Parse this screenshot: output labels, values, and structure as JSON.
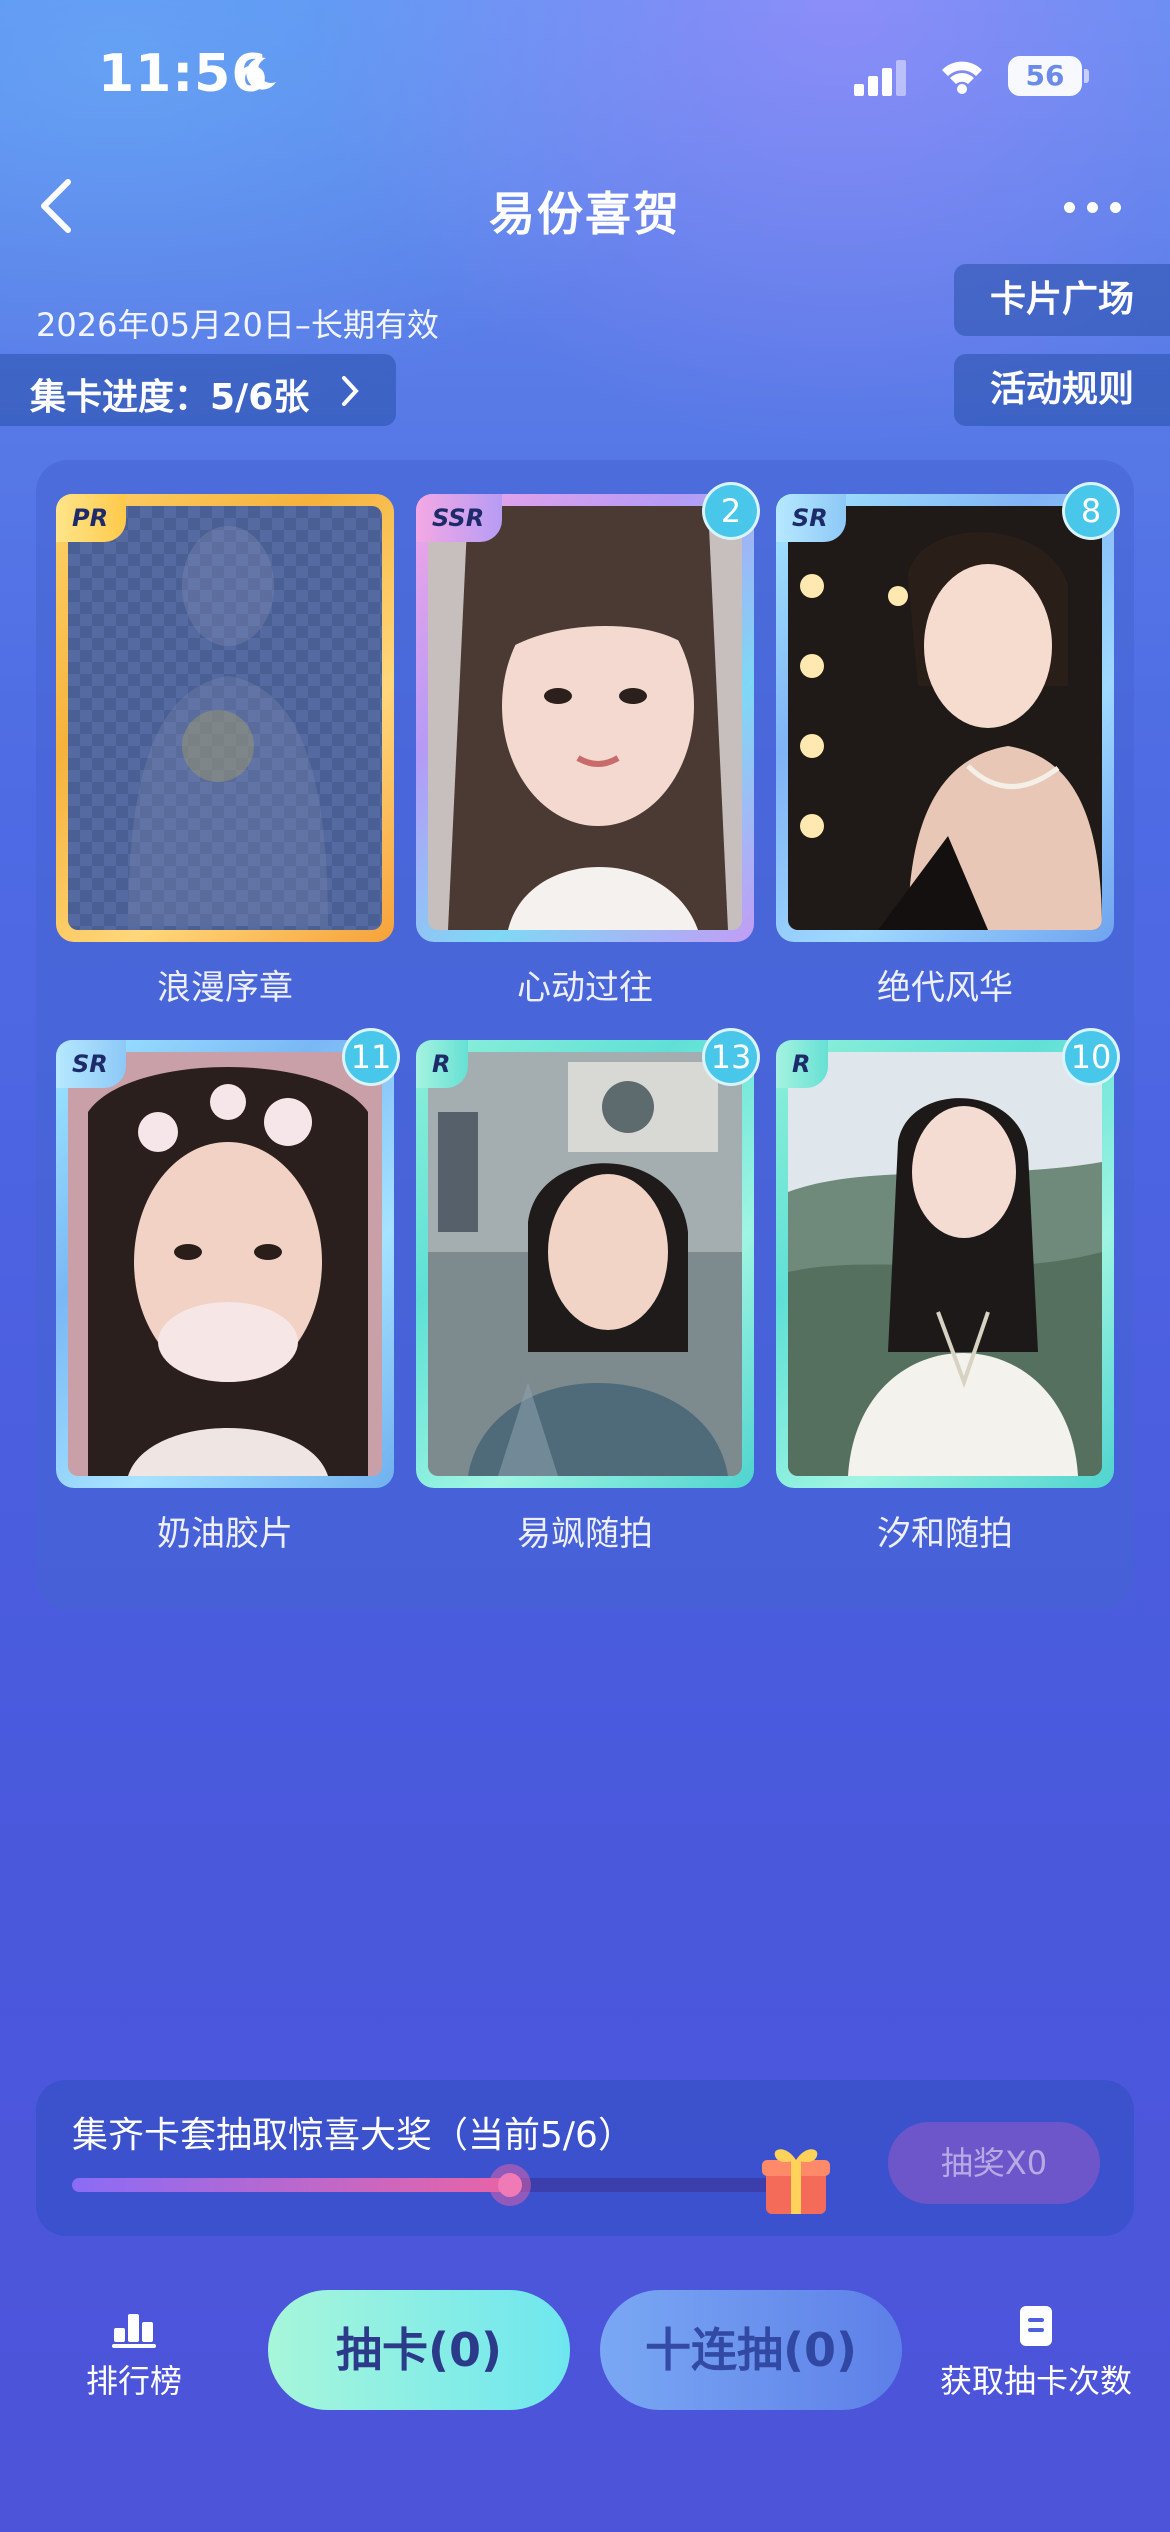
{
  "status_bar": {
    "time": "11:56",
    "battery": "56"
  },
  "header": {
    "title": "易份喜贺"
  },
  "event": {
    "date_range": "2026年05月20日–长期有效"
  },
  "progress_chip": {
    "label": "集卡进度：5/6张"
  },
  "side_buttons": {
    "plaza": "卡片广场",
    "rules": "活动规则"
  },
  "cards": [
    {
      "name": "浪漫序章",
      "rarity": "PR",
      "count": ""
    },
    {
      "name": "心动过往",
      "rarity": "SSR",
      "count": "2"
    },
    {
      "name": "绝代风华",
      "rarity": "SR",
      "count": "8"
    },
    {
      "name": "奶油胶片",
      "rarity": "SR",
      "count": "11"
    },
    {
      "name": "易飒随拍",
      "rarity": "R",
      "count": "13"
    },
    {
      "name": "汐和随拍",
      "rarity": "R",
      "count": "10"
    }
  ],
  "reward": {
    "title": "集齐卡套抽取惊喜大奖（当前5/6）",
    "progress": 0.833,
    "button": "抽奖X0"
  },
  "bottom_bar": {
    "leaderboard": "排行榜",
    "draw": "抽卡(0)",
    "draw_ten": "十连抽(0)",
    "get_chances": "获取抽卡次数"
  },
  "colors": {
    "gold_frame": "#f7c04a",
    "ssr_frame": "#c79cf6",
    "teal_frame": "#5fe0d6",
    "count_badge": "#49c7ea",
    "draw_button": "#a7f6da"
  }
}
